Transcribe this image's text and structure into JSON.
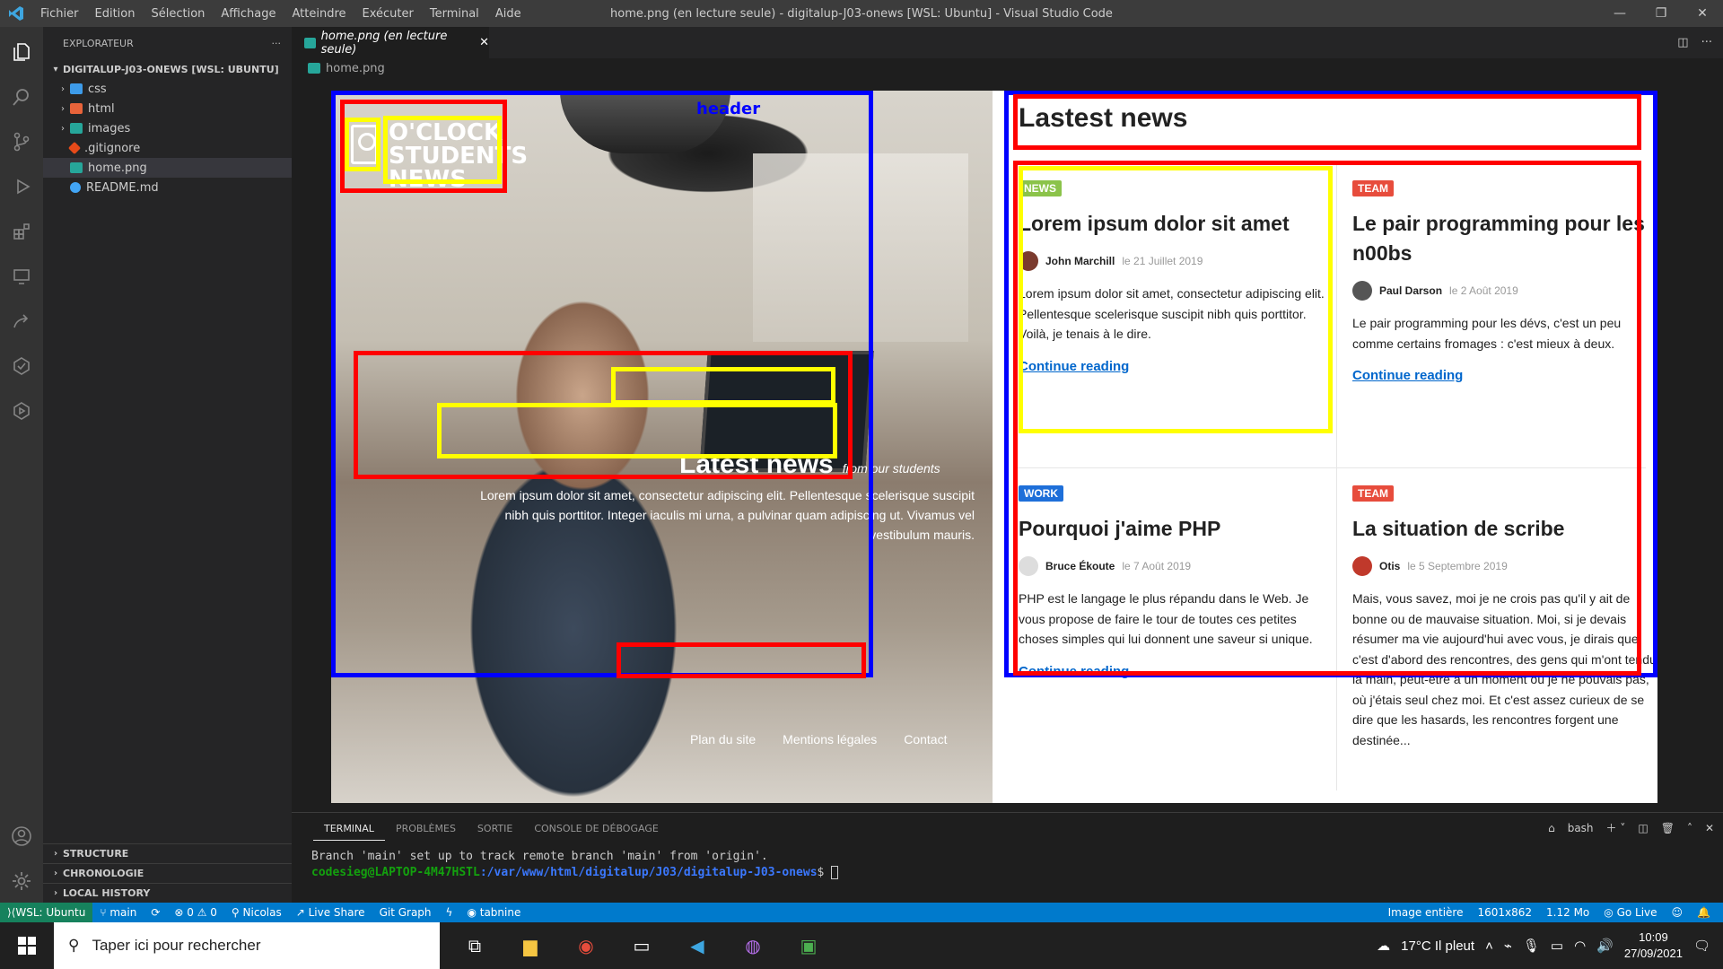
{
  "titlebar": {
    "menu": [
      "Fichier",
      "Edition",
      "Sélection",
      "Affichage",
      "Atteindre",
      "Exécuter",
      "Terminal",
      "Aide"
    ],
    "title": "home.png (en lecture seule) - digitalup-J03-onews [WSL: Ubuntu] - Visual Studio Code"
  },
  "sidebar": {
    "header": "EXPLORATEUR",
    "more": "···",
    "root": "DIGITALUP-J03-ONEWS [WSL: UBUNTU]",
    "items": [
      {
        "label": "css",
        "type": "folder"
      },
      {
        "label": "html",
        "type": "folder"
      },
      {
        "label": "images",
        "type": "folder"
      },
      {
        "label": ".gitignore",
        "type": "file"
      },
      {
        "label": "home.png",
        "type": "file"
      },
      {
        "label": "README.md",
        "type": "file"
      }
    ],
    "sections": [
      "STRUCTURE",
      "CHRONOLOGIE",
      "LOCAL HISTORY"
    ]
  },
  "tabs": {
    "active": "home.png (en lecture seule)",
    "close": "✕",
    "breadcrumb": "home.png"
  },
  "image": {
    "brand": "O'CLOCK STUDENTS NEWS",
    "header_label": "header",
    "latest_title": "Latest news",
    "latest_sub": "from our students",
    "latest_desc": "Lorem ipsum dolor sit amet, consectetur adipiscing elit. Pellentesque scelerisque suscipit nibh quis porttitor. Integer iaculis mi urna, a pulvinar quam adipiscing ut. Vivamus vel vestibulum mauris.",
    "footer_links": [
      "Plan du site",
      "Mentions légales",
      "Contact"
    ],
    "news_heading": "Lastest news",
    "cards": [
      {
        "badge": "NEWS",
        "badge_color": "#8bc34a",
        "title": "Lorem ipsum dolor sit amet",
        "author": "John Marchill",
        "date": "le 21 Juillet 2019",
        "text": "Lorem ipsum dolor sit amet, consectetur adipiscing elit. Pellentesque scelerisque suscipit nibh quis porttitor. Voilà, je tenais à le dire.",
        "link": "Continue reading"
      },
      {
        "badge": "TEAM",
        "badge_color": "#e74c3c",
        "title": "Le pair programming pour les n00bs",
        "author": "Paul Darson",
        "date": "le 2 Août 2019",
        "text": "Le pair programming pour les dévs, c'est un peu comme certains fromages : c'est mieux à deux.",
        "link": "Continue reading"
      },
      {
        "badge": "WORK",
        "badge_color": "#1e6fd9",
        "title": "Pourquoi j'aime PHP",
        "author": "Bruce Ékoute",
        "date": "le 7 Août 2019",
        "text": "PHP est le langage le plus répandu dans le Web. Je vous propose de faire le tour de toutes ces petites choses simples qui lui donnent une saveur si unique.",
        "link": "Continue reading"
      },
      {
        "badge": "TEAM",
        "badge_color": "#e74c3c",
        "title": "La situation de scribe",
        "author": "Otis",
        "date": "le 5 Septembre 2019",
        "text": "Mais, vous savez, moi je ne crois pas qu'il y ait de bonne ou de mauvaise situation. Moi, si je devais résumer ma vie aujourd'hui avec vous, je dirais que c'est d'abord des rencontres, des gens qui m'ont tendu la main, peut-être à un moment où je ne pouvais pas, où j'étais seul chez moi. Et c'est assez curieux de se dire que les hasards, les rencontres forgent une destinée...",
        "link": "Continue reading"
      }
    ]
  },
  "panel": {
    "tabs": [
      "TERMINAL",
      "PROBLÈMES",
      "SORTIE",
      "CONSOLE DE DÉBOGAGE"
    ],
    "shell": "bash",
    "line1": "Branch 'main' set up to track remote branch 'main' from 'origin'.",
    "prompt_user": "codesieg@LAPTOP-4M47HSTL",
    "prompt_path": ":/var/www/html/digitalup/J03/digitalup-J03-onews",
    "prompt_end": "$ "
  },
  "status": {
    "remote": "WSL: Ubuntu",
    "branch": "main",
    "errors": "⊗ 0 ⚠ 0",
    "user": "Nicolas",
    "liveshare": "Live Share",
    "gitgraph": "Git Graph",
    "tabnine": "tabnine",
    "image_mode": "Image entière",
    "dims": "1601x862",
    "size": "1.12 Mo",
    "golive": "Go Live"
  },
  "taskbar": {
    "search": "Taper ici pour rechercher",
    "weather": "17°C  Il pleut",
    "time": "10:09",
    "date": "27/09/2021"
  }
}
